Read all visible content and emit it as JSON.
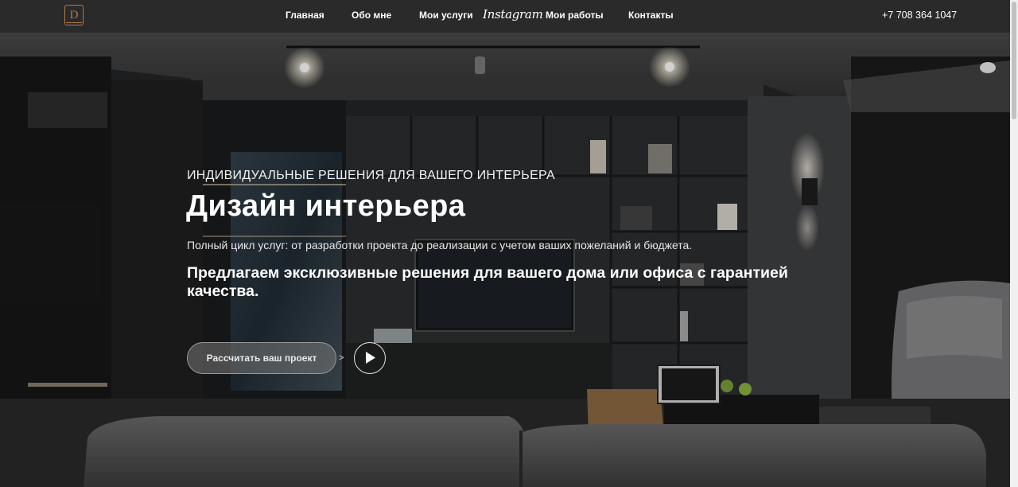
{
  "header": {
    "logo_letter": "D",
    "nav": [
      "Главная",
      "Обо мне",
      "Мои услуги",
      "Мои работы",
      "Контакты"
    ],
    "instagram": "Instagram",
    "phone": "+7 708 364 1047"
  },
  "hero": {
    "eyebrow": "ИНДИВИДУАЛЬНЫЕ РЕШЕНИЯ ДЛЯ ВАШЕГО ИНТЕРЬЕРА",
    "title": "Дизайн интерьера",
    "description": "Полный цикл услуг: от разработки проекта до реализации с учетом ваших пожеланий и бюджета.",
    "pitch": "Предлагаем эксклюзивные решения для вашего дома или офиса с гарантией качества.",
    "cta_label": "Рассчитать ваш проект",
    "arrow": ">"
  },
  "icons": [
    "logo-icon",
    "play-icon"
  ],
  "colors": {
    "accent": "#b07a45",
    "header_bg": "#2a2a2b"
  }
}
